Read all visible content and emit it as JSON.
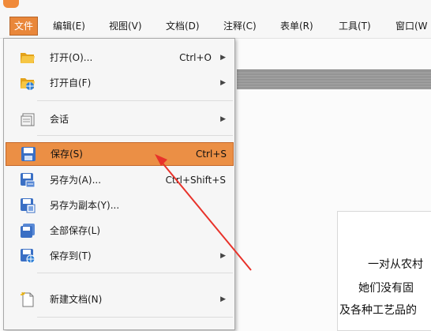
{
  "menubar": {
    "items": [
      {
        "label": "文件",
        "active": true
      },
      {
        "label": "编辑(E)"
      },
      {
        "label": "视图(V)"
      },
      {
        "label": "文档(D)"
      },
      {
        "label": "注释(C)"
      },
      {
        "label": "表单(R)"
      },
      {
        "label": "工具(T)"
      },
      {
        "label": "窗口(W"
      }
    ]
  },
  "file_menu": {
    "open": {
      "label": "打开(O)...",
      "shortcut": "Ctrl+O",
      "icon": "folder-open-icon"
    },
    "open_from": {
      "label": "打开自(F)",
      "icon": "folder-globe-icon"
    },
    "session": {
      "label": "会话",
      "icon": "session-icon"
    },
    "save": {
      "label": "保存(S)",
      "shortcut": "Ctrl+S",
      "icon": "save-icon"
    },
    "save_as": {
      "label": "另存为(A)...",
      "shortcut": "Ctrl+Shift+S",
      "icon": "save-as-icon"
    },
    "save_copy": {
      "label": "另存为副本(Y)...",
      "icon": "save-copy-icon"
    },
    "save_all": {
      "label": "全部保存(L)",
      "icon": "save-all-icon"
    },
    "save_to": {
      "label": "保存到(T)",
      "icon": "save-to-icon"
    },
    "new_doc": {
      "label": "新建文档(N)",
      "icon": "new-document-icon"
    }
  },
  "document": {
    "lines": [
      "一对从农村",
      "她们没有固",
      "及各种工艺品的"
    ]
  },
  "colors": {
    "accent": "#eb8f45",
    "pointer": "#e8322a"
  }
}
